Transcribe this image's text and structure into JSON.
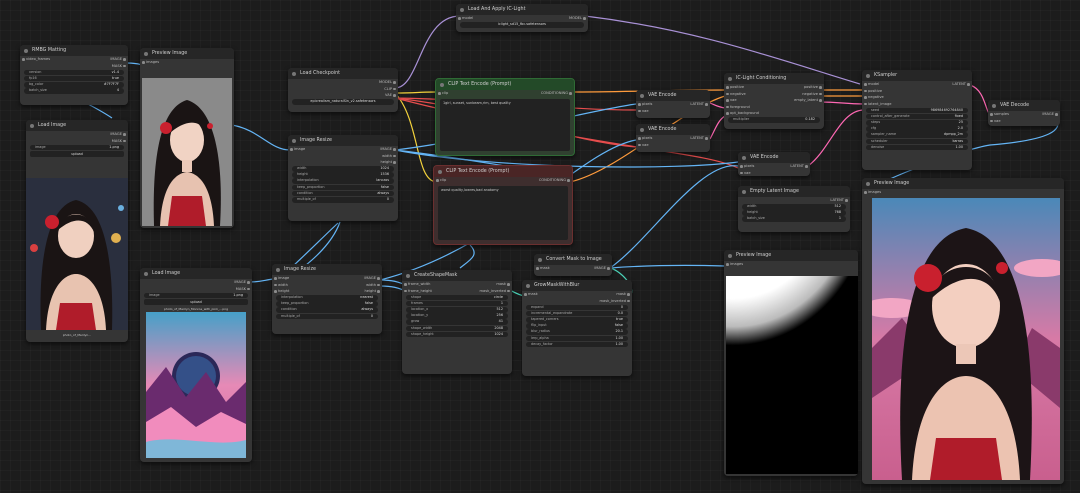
{
  "nodes": {
    "rmbg": {
      "title": "RMBG Matting",
      "inputs": [
        "video_frames"
      ],
      "outputs": [
        "IMAGE",
        "MASK"
      ],
      "widgets": [
        {
          "k": "version",
          "v": "v1.4"
        },
        {
          "k": "fp16",
          "v": "true"
        },
        {
          "k": "bg_color",
          "v": "#7F7F7F"
        },
        {
          "k": "batch_size",
          "v": "4"
        }
      ]
    },
    "preview1": {
      "title": "Preview Image",
      "input": "images"
    },
    "loadimg1": {
      "title": "Load Image",
      "outputs": [
        "IMAGE",
        "MASK"
      ],
      "widgets": [
        {
          "k": "image",
          "v": "1.png"
        }
      ],
      "button": "upload",
      "filename": "photo_of_Marilyn..."
    },
    "loadckpt": {
      "title": "Load Checkpoint",
      "outputs": [
        "MODEL",
        "CLIP",
        "VAE"
      ],
      "ckpt": "epicrealism_naturalSin_v2.safetensors"
    },
    "resize1": {
      "title": "Image Resize",
      "inputs": [
        "image"
      ],
      "outputs": [
        "IMAGE",
        "width",
        "height"
      ],
      "widgets": [
        {
          "k": "width",
          "v": "1024"
        },
        {
          "k": "height",
          "v": "1536"
        },
        {
          "k": "interpolation",
          "v": "lanczos"
        },
        {
          "k": "keep_proportion",
          "v": "false"
        },
        {
          "k": "condition",
          "v": "always"
        },
        {
          "k": "multiple_of",
          "v": "0"
        }
      ]
    },
    "iclight": {
      "title": "Load And Apply IC-Light",
      "inputs": [
        "model"
      ],
      "outputs": [
        "MODEL"
      ],
      "model_path": "iclight_sd15_fbc.safetensors"
    },
    "cliptop": {
      "title": "CLIP Text Encode (Prompt)",
      "inputs": [
        "clip"
      ],
      "outputs": [
        "CONDITIONING"
      ],
      "text": "1girl, sunset, sunbeam,rim, best quality"
    },
    "clipbot": {
      "title": "CLIP Text Encode (Prompt)",
      "inputs": [
        "clip"
      ],
      "outputs": [
        "CONDITIONING"
      ],
      "text": "worst quality,lowres,bad anatomy"
    },
    "vaeenc1": {
      "title": "VAE Encode",
      "inputs": [
        "pixels",
        "vae"
      ],
      "outputs": [
        "LATENT"
      ]
    },
    "vaeenc2": {
      "title": "VAE Encode",
      "inputs": [
        "pixels",
        "vae"
      ],
      "outputs": [
        "LATENT"
      ]
    },
    "iccond": {
      "title": "IC-Light Conditioning",
      "inputs": [
        "positive",
        "negative",
        "vae",
        "foreground",
        "opt_background"
      ],
      "outputs": [
        "positive",
        "negative",
        "empty_latent"
      ],
      "widgets": [
        {
          "k": "multiplier",
          "v": "0.182"
        }
      ]
    },
    "ksampler": {
      "title": "KSampler",
      "inputs": [
        "model",
        "positive",
        "negative",
        "latent_image"
      ],
      "outputs": [
        "LATENT"
      ],
      "widgets": [
        {
          "k": "seed",
          "v": "986984692764840"
        },
        {
          "k": "control_after_generate",
          "v": "fixed"
        },
        {
          "k": "steps",
          "v": "25"
        },
        {
          "k": "cfg",
          "v": "2.0"
        },
        {
          "k": "sampler_name",
          "v": "dpmpp_2m"
        },
        {
          "k": "scheduler",
          "v": "karras"
        },
        {
          "k": "denoise",
          "v": "1.00"
        }
      ]
    },
    "vaedec": {
      "title": "VAE Decode",
      "inputs": [
        "samples",
        "vae"
      ],
      "outputs": [
        "IMAGE"
      ]
    },
    "vaeenc3": {
      "title": "VAE Encode",
      "inputs": [
        "pixels",
        "vae"
      ],
      "outputs": [
        "LATENT"
      ]
    },
    "emptylat": {
      "title": "Empty Latent Image",
      "outputs": [
        "LATENT"
      ],
      "widgets": [
        {
          "k": "width",
          "v": "512"
        },
        {
          "k": "height",
          "v": "768"
        },
        {
          "k": "batch_size",
          "v": "1"
        }
      ]
    },
    "preview2": {
      "title": "Preview Image",
      "input": "images"
    },
    "loadimg2": {
      "title": "Load Image",
      "outputs": [
        "IMAGE",
        "MASK"
      ],
      "filename": "photo_of_Marilyn_Monroe_with_pink_...png",
      "widgets": [
        {
          "k": "image",
          "v": "1.png"
        }
      ],
      "button": "upload"
    },
    "resize2": {
      "title": "Image Resize",
      "inputs": [
        "image",
        "width",
        "height"
      ],
      "outputs": [
        "IMAGE",
        "width",
        "height"
      ],
      "widgets": [
        {
          "k": "interpolation",
          "v": "nearest"
        },
        {
          "k": "keep_proportion",
          "v": "false"
        },
        {
          "k": "condition",
          "v": "always"
        },
        {
          "k": "multiple_of",
          "v": "0"
        }
      ]
    },
    "shapemask": {
      "title": "CreateShapeMask",
      "inputs": [
        "frame_width",
        "frame_height"
      ],
      "outputs": [
        "mask",
        "mask_inverted"
      ],
      "widgets": [
        {
          "k": "shape",
          "v": "circle"
        },
        {
          "k": "frames",
          "v": "1"
        },
        {
          "k": "location_x",
          "v": "512"
        },
        {
          "k": "location_y",
          "v": "256"
        },
        {
          "k": "grow",
          "v": "41"
        },
        {
          "k": "shape_width",
          "v": "2048"
        },
        {
          "k": "shape_height",
          "v": "1024"
        }
      ]
    },
    "convmask": {
      "title": "Convert Mask to Image",
      "inputs": [
        "mask"
      ],
      "outputs": [
        "IMAGE"
      ]
    },
    "growmask": {
      "title": "GrowMaskWithBlur",
      "inputs": [
        "mask"
      ],
      "outputs": [
        "mask",
        "mask_inverted"
      ],
      "widgets": [
        {
          "k": "expand",
          "v": "0"
        },
        {
          "k": "incremental_expandrate",
          "v": "0.0"
        },
        {
          "k": "tapered_corners",
          "v": "true"
        },
        {
          "k": "flip_input",
          "v": "false"
        },
        {
          "k": "blur_radius",
          "v": "20.1"
        },
        {
          "k": "lerp_alpha",
          "v": "1.00"
        },
        {
          "k": "decay_factor",
          "v": "1.00"
        }
      ]
    },
    "preview3": {
      "title": "Preview Image",
      "input": "images"
    },
    "preview4": {
      "title": "Preview Image",
      "input": "images"
    }
  }
}
